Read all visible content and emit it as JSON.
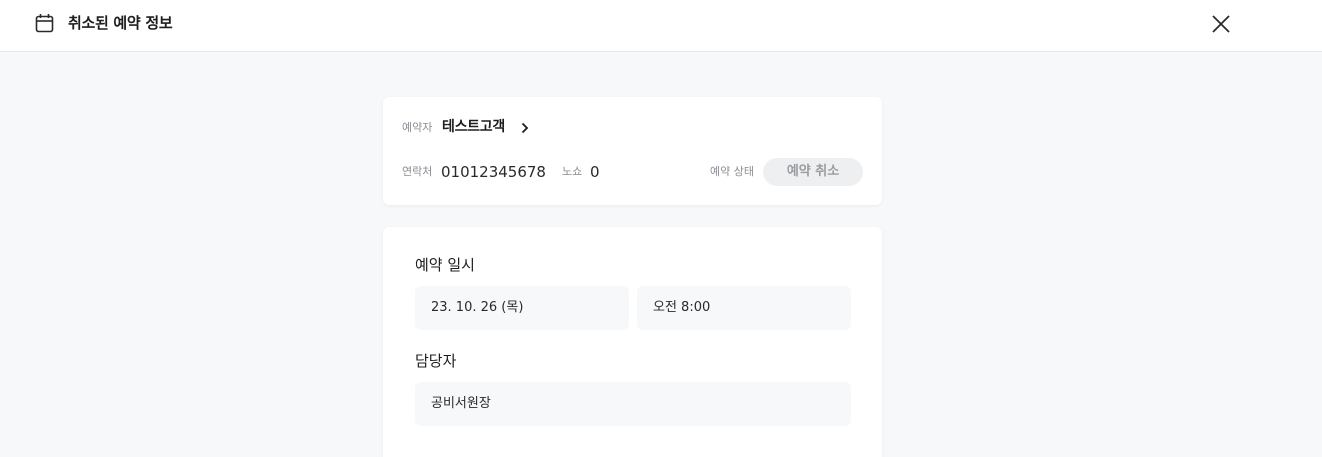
{
  "header": {
    "title": "취소된 예약 정보",
    "icons": {
      "calendar": "calendar-icon",
      "close": "close-icon"
    }
  },
  "summary": {
    "booker_label": "예약자",
    "booker_name": "테스트고객",
    "contact_label": "연락처",
    "contact_value": "01012345678",
    "noshow_label": "노쇼",
    "noshow_value": "0",
    "status_label": "예약 상태",
    "status_value": "예약 취소"
  },
  "details": {
    "datetime_title": "예약 일시",
    "date_value": "23. 10. 26 (목)",
    "time_value": "오전 8:00",
    "staff_title": "담당자",
    "staff_value": "공비서원장"
  },
  "colors": {
    "background": "#f7f8fa",
    "card": "#ffffff",
    "status_pill": "#eeeff1",
    "status_text": "#9a9ca1"
  }
}
